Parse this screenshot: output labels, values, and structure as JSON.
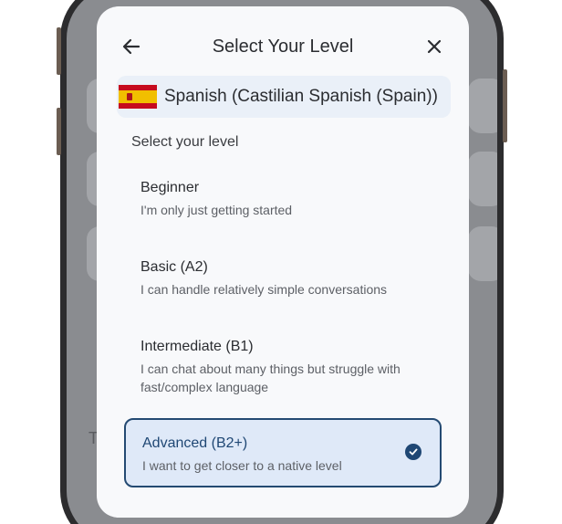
{
  "header": {
    "title": "Select Your Level",
    "back_icon": "arrow-left-icon",
    "close_icon": "close-icon"
  },
  "language": {
    "label": "Spanish (Castilian Spanish (Spain))",
    "flag_icon": "spain-flag-icon"
  },
  "section_label": "Select your level",
  "levels": [
    {
      "title": "Beginner",
      "description": "I'm only just getting started",
      "selected": false
    },
    {
      "title": "Basic (A2)",
      "description": "I can handle relatively simple conversations",
      "selected": false
    },
    {
      "title": "Intermediate (B1)",
      "description": "I can chat about many things but struggle with fast/complex language",
      "selected": false
    },
    {
      "title": "Advanced (B2+)",
      "description": "I want to get closer to a native level",
      "selected": true
    }
  ],
  "background": {
    "partial_letter": "T"
  },
  "colors": {
    "accent": "#1f4774",
    "selected_bg": "#dfe9f8",
    "sheet_bg": "#f8f9fb",
    "chip_bg": "#eaf0f8"
  }
}
